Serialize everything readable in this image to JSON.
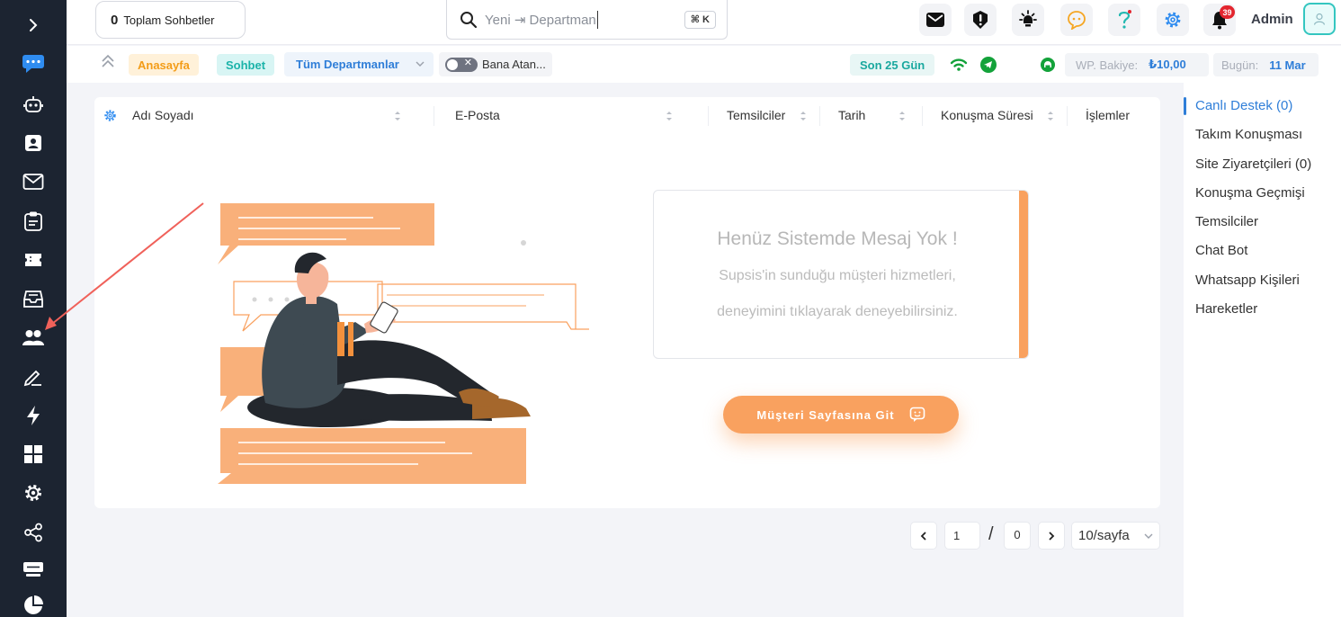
{
  "sidebar": {
    "items": [
      {
        "icon": "chevron-right-icon"
      },
      {
        "icon": "chat-icon",
        "active": true
      },
      {
        "icon": "robot-icon"
      },
      {
        "icon": "contact-card-icon"
      },
      {
        "icon": "mail-icon"
      },
      {
        "icon": "clipboard-icon"
      },
      {
        "icon": "ticket-icon"
      },
      {
        "icon": "inbox-icon"
      },
      {
        "icon": "users-icon"
      },
      {
        "icon": "pen-icon"
      },
      {
        "icon": "bolt-icon"
      },
      {
        "icon": "grid-icon"
      },
      {
        "icon": "gear-icon"
      },
      {
        "icon": "share-icon"
      },
      {
        "icon": "keyboard-icon"
      },
      {
        "icon": "pie-chart-icon"
      }
    ]
  },
  "header": {
    "total_count": "0",
    "total_label": "Toplam Sohbetler",
    "search_text": "Yeni ⇥ Departman",
    "search_shortcut": "⌘ K",
    "notification_count": "39",
    "user_name": "Admin"
  },
  "subbar": {
    "home_label": "Anasayfa",
    "chat_label": "Sohbet",
    "department_select": "Tüm Departmanlar",
    "assigned_toggle_label": "Bana Atan...",
    "period_label": "Son 25 Gün",
    "wp_balance_label": "WP. Bakiye:",
    "wp_balance_value": "₺10,00",
    "today_label": "Bugün:",
    "today_value": "11 Mar"
  },
  "table": {
    "columns": [
      "Adı Soyadı",
      "E-Posta",
      "Temsilciler",
      "Tarih",
      "Konuşma Süresi",
      "İşlemler"
    ]
  },
  "empty_state": {
    "title": "Henüz Sistemde Mesaj Yok !",
    "line1": "Supsis'in sunduğu müşteri hizmetleri,",
    "line2": "deneyimini tıklayarak deneyebilirsiniz.",
    "button_label": "Müşteri Sayfasına Git"
  },
  "pagination": {
    "current_page": "1",
    "total_pages": "0",
    "page_size": "10/sayfa"
  },
  "right_nav": {
    "items": [
      "Canlı Destek (0)",
      "Takım Konuşması",
      "Site Ziyaretçileri (0)",
      "Konuşma Geçmişi",
      "Temsilciler",
      "Chat Bot",
      "Whatsapp Kişileri",
      "Hareketler"
    ]
  },
  "colors": {
    "accent_orange": "#f9a15f",
    "primary_blue": "#2f7ed8",
    "sidebar_bg": "#1c2431",
    "annotation_arrow": "#f0615a"
  }
}
